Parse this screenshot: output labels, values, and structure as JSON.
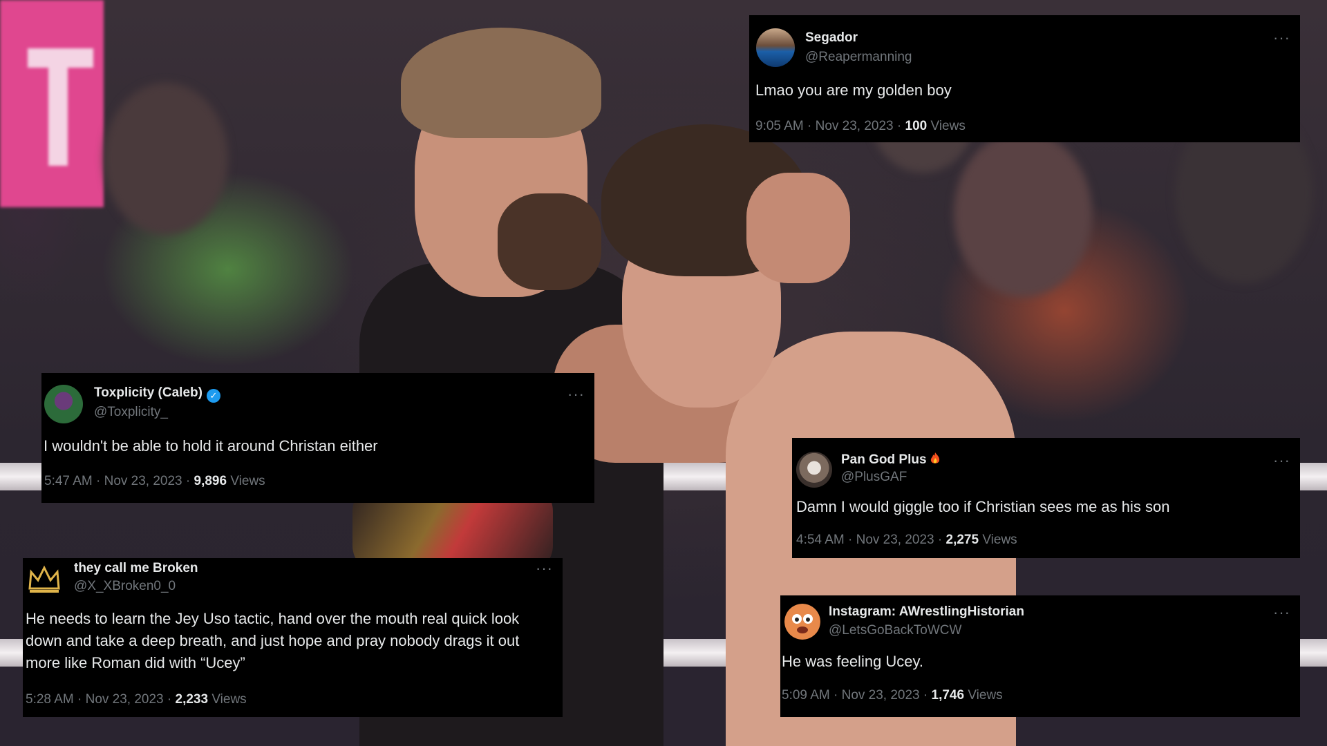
{
  "tweets": [
    {
      "id": "segador",
      "name": "Segador",
      "handle": "@Reapermanning",
      "text": "Lmao you are my golden boy",
      "time": "9:05 AM · Nov 23, 2023 · ",
      "views_count": "100",
      "views_label": " Views",
      "verified": false
    },
    {
      "id": "toxplicity",
      "name": "Toxplicity (Caleb)",
      "handle": "@Toxplicity_",
      "text": "I wouldn't be able to hold it around Christan either",
      "time": "5:47 AM · Nov 23, 2023 · ",
      "views_count": "9,896",
      "views_label": " Views",
      "verified": true
    },
    {
      "id": "pangod",
      "name": "Pan God Plus",
      "handle": "@PlusGAF",
      "text": "Damn I would giggle too if Christian sees me as his son",
      "time": "4:54 AM · Nov 23, 2023 · ",
      "views_count": "2,275",
      "views_label": " Views",
      "verified": false
    },
    {
      "id": "broken",
      "name": "they call me Broken",
      "handle": "@X_XBroken0_0",
      "text": "He needs to learn the Jey Uso tactic, hand over the mouth real quick look down and take a deep breath, and just hope and pray nobody drags it out more like Roman did with “Ucey”",
      "time": "5:28 AM · Nov 23, 2023 · ",
      "views_count": "2,233",
      "views_label": " Views",
      "verified": false
    },
    {
      "id": "historian",
      "name": "Instagram: AWrestlingHistorian",
      "handle": "@LetsGoBackToWCW",
      "text": "He was feeling Ucey.",
      "time": "5:09 AM · Nov 23, 2023 · ",
      "views_count": "1,746",
      "views_label": " Views",
      "verified": false
    }
  ],
  "more_glyph": "···",
  "verified_glyph": "✓",
  "colors": {
    "card_bg": "#000000",
    "text": "#e7e9ea",
    "muted": "#71767b",
    "verified": "#1d9bf0"
  }
}
